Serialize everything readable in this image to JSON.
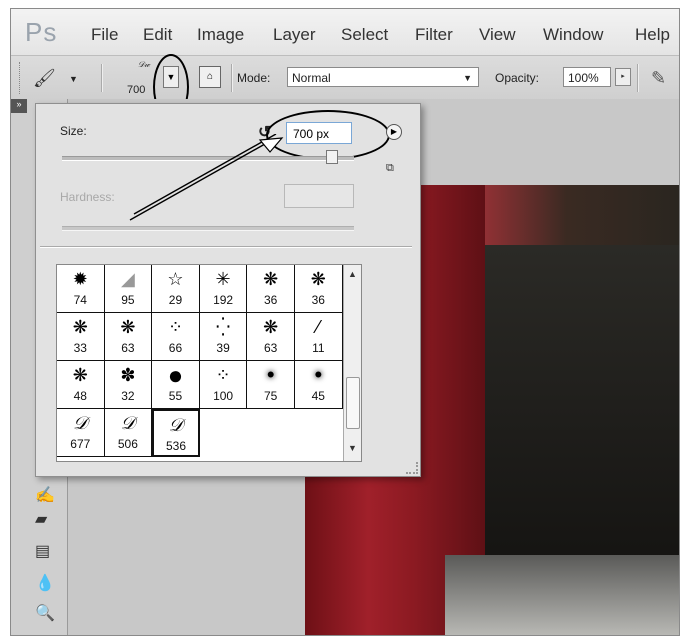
{
  "app": {
    "logo": "Ps"
  },
  "menu": [
    "File",
    "Edit",
    "Image",
    "Layer",
    "Select",
    "Filter",
    "View",
    "Window",
    "Help"
  ],
  "options_bar": {
    "brush_preset_size": "700",
    "mode_label": "Mode:",
    "mode_value": "Normal",
    "opacity_label": "Opacity:",
    "opacity_value": "100%"
  },
  "brush_picker": {
    "size_label": "Size:",
    "size_value": "700 px",
    "hardness_label": "Hardness:",
    "size_slider_fraction": 0.92,
    "presets": [
      {
        "size": "74",
        "kind": "leaf",
        "glyph": "✹"
      },
      {
        "size": "95",
        "kind": "soft-leaf",
        "glyph": "◢"
      },
      {
        "size": "29",
        "kind": "star",
        "glyph": "☆"
      },
      {
        "size": "192",
        "kind": "burst",
        "glyph": "✳"
      },
      {
        "size": "36",
        "kind": "splatter",
        "glyph": "❋"
      },
      {
        "size": "36",
        "kind": "splatter",
        "glyph": "❋"
      },
      {
        "size": "33",
        "kind": "splatter",
        "glyph": "❋"
      },
      {
        "size": "63",
        "kind": "splatter",
        "glyph": "❋"
      },
      {
        "size": "66",
        "kind": "spray",
        "glyph": "⁘"
      },
      {
        "size": "39",
        "kind": "spray",
        "glyph": "⁛"
      },
      {
        "size": "63",
        "kind": "splatter",
        "glyph": "❋"
      },
      {
        "size": "11",
        "kind": "dash",
        "glyph": "⁄"
      },
      {
        "size": "48",
        "kind": "splatter",
        "glyph": "❋"
      },
      {
        "size": "32",
        "kind": "splatter",
        "glyph": "✽"
      },
      {
        "size": "55",
        "kind": "hard-round",
        "glyph": "●"
      },
      {
        "size": "100",
        "kind": "spray",
        "glyph": "⁘"
      },
      {
        "size": "75",
        "kind": "soft-round",
        "glyph": "•"
      },
      {
        "size": "45",
        "kind": "soft-round",
        "glyph": "•"
      },
      {
        "size": "677",
        "kind": "signature",
        "glyph": "𝒟"
      },
      {
        "size": "506",
        "kind": "signature",
        "glyph": "𝒟"
      },
      {
        "size": "536",
        "kind": "signature",
        "glyph": "𝒟",
        "selected": true
      }
    ]
  }
}
